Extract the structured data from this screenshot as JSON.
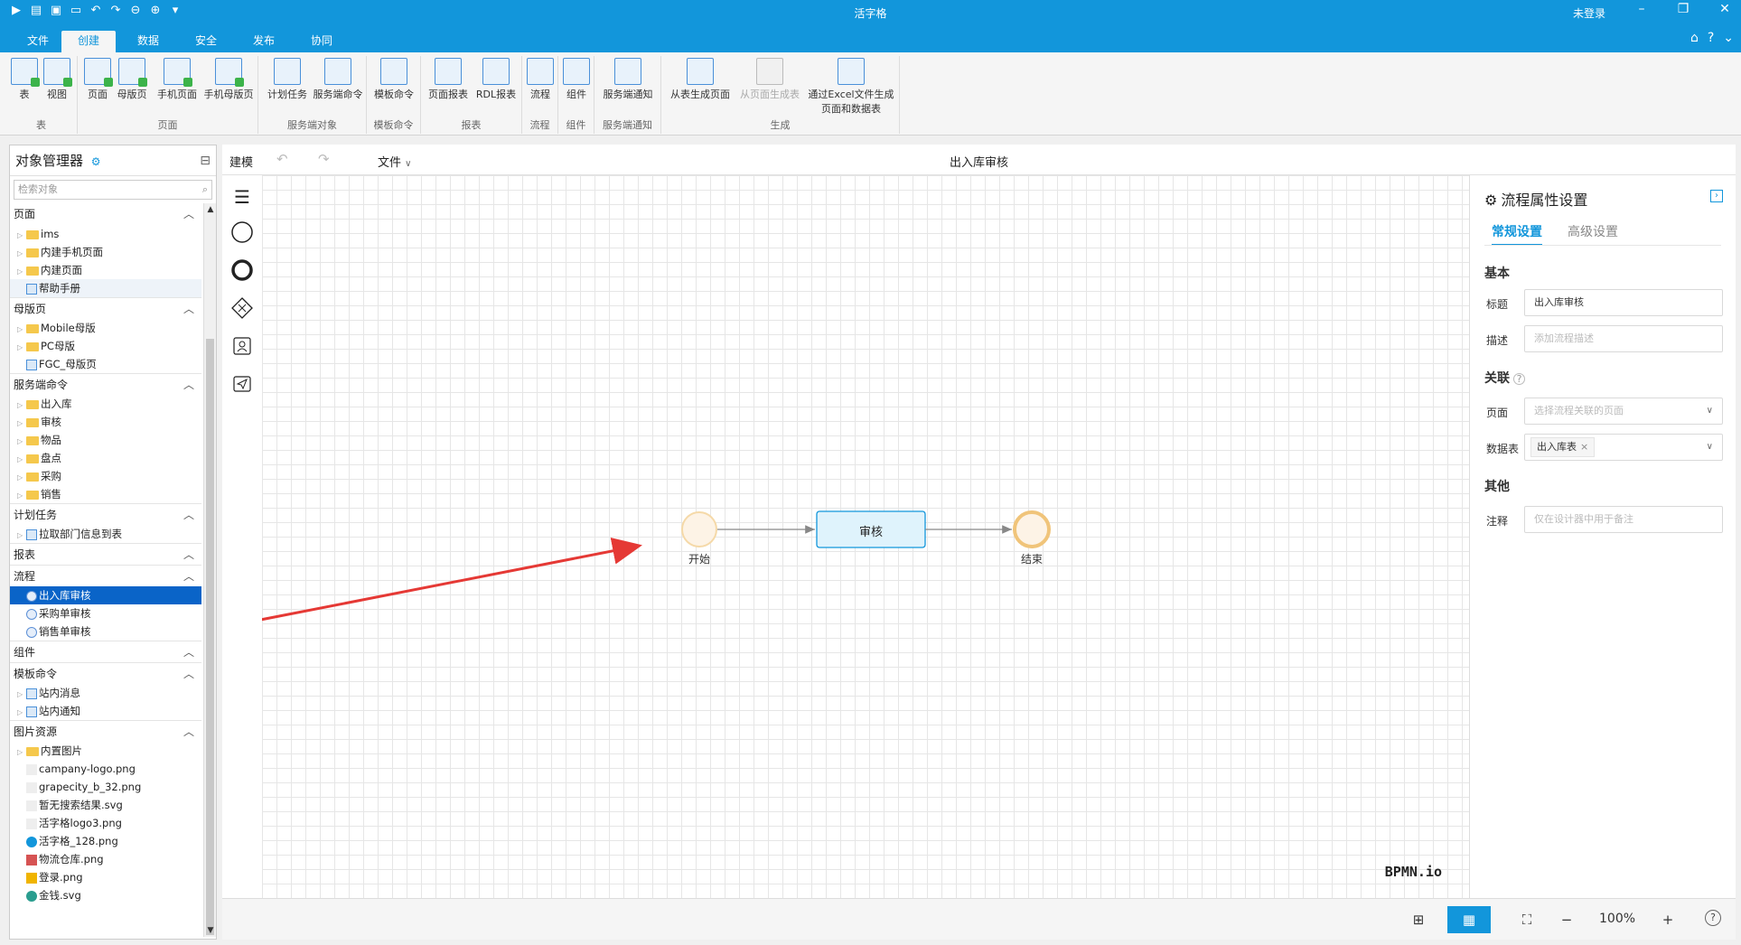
{
  "window": {
    "title": "活字格",
    "login_status": "未登录"
  },
  "ribbon_tabs": [
    "文件",
    "创建",
    "数据",
    "安全",
    "发布",
    "协同"
  ],
  "ribbon": {
    "groups": [
      {
        "label": "表",
        "buttons": [
          "表",
          "视图"
        ]
      },
      {
        "label": "页面",
        "buttons": [
          "页面",
          "母版页",
          "手机页面",
          "手机母版页"
        ]
      },
      {
        "label": "服务端对象",
        "buttons": [
          "计划任务",
          "服务端命令"
        ]
      },
      {
        "label": "模板命令",
        "buttons": [
          "模板命令"
        ]
      },
      {
        "label": "报表",
        "buttons": [
          "页面报表",
          "RDL报表"
        ]
      },
      {
        "label": "流程",
        "buttons": [
          "流程"
        ]
      },
      {
        "label": "组件",
        "buttons": [
          "组件"
        ]
      },
      {
        "label": "服务端通知",
        "buttons": [
          "服务端通知"
        ]
      },
      {
        "label": "生成",
        "buttons": [
          "从表生成页面",
          "从页面生成表",
          "通过Excel文件生成\n页面和数据表"
        ]
      }
    ]
  },
  "left_panel": {
    "title": "对象管理器",
    "search_placeholder": "检索对象",
    "sections": [
      {
        "name": "页面",
        "items": [
          "ims",
          "内建手机页面",
          "内建页面",
          "帮助手册"
        ]
      },
      {
        "name": "母版页",
        "items": [
          "Mobile母版",
          "PC母版",
          "FGC_母版页"
        ]
      },
      {
        "name": "服务端命令",
        "items": [
          "出入库",
          "审核",
          "物品",
          "盘点",
          "采购",
          "销售"
        ]
      },
      {
        "name": "计划任务",
        "items": [
          "拉取部门信息到表"
        ]
      },
      {
        "name": "报表",
        "items": []
      },
      {
        "name": "流程",
        "items": [
          "出入库审核",
          "采购单审核",
          "销售单审核"
        ],
        "selected": "出入库审核"
      },
      {
        "name": "组件",
        "items": []
      },
      {
        "name": "模板命令",
        "items": [
          "站内消息",
          "站内通知"
        ]
      },
      {
        "name": "图片资源",
        "items": [
          "内置图片",
          "campany-logo.png",
          "grapecity_b_32.png",
          "暂无搜索结果.svg",
          "活字格logo3.png",
          "活字格_128.png",
          "物流仓库.png",
          "登录.png",
          "金钱.svg"
        ]
      }
    ]
  },
  "editor": {
    "mode_label": "建模",
    "file_menu": "文件",
    "title": "出入库审核",
    "nodes": {
      "start": "开始",
      "task": "审核",
      "end": "结束"
    },
    "watermark": "BPMN.io",
    "zoom": "100%"
  },
  "properties": {
    "title": "流程属性设置",
    "tabs": [
      "常规设置",
      "高级设置"
    ],
    "sections": {
      "basic": "基本",
      "relation": "关联",
      "other": "其他"
    },
    "fields": {
      "title_label": "标题",
      "title_value": "出入库审核",
      "desc_label": "描述",
      "desc_placeholder": "添加流程描述",
      "page_label": "页面",
      "page_placeholder": "选择流程关联的页面",
      "table_label": "数据表",
      "table_value": "出入库表",
      "note_label": "注释",
      "note_placeholder": "仅在设计器中用于备注"
    }
  },
  "colors": {
    "accent": "#1296db",
    "selected_row": "#0a64c8",
    "task_fill": "#dff3fc",
    "arrow": "#e53935",
    "start_fill": "#fdf3e6"
  }
}
